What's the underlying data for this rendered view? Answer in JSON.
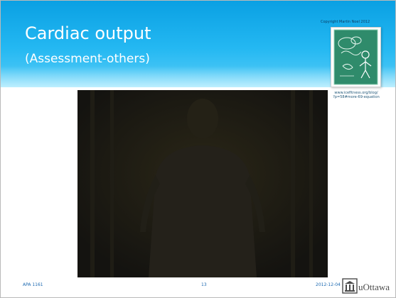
{
  "slide": {
    "title": "Cardiac output",
    "subtitle": "(Assessment-others)",
    "copyright": "Copyright Martin Noel 2012",
    "cartoon_url_line1": "www.icefitness.org/blog/",
    "cartoon_url_line2": "?p=58#more-69-equation"
  },
  "footer": {
    "course": "APA 1161",
    "page_number": "13",
    "date": "2012-12-04",
    "logo_text": "uOttawa",
    "logo_icon": "university-building-icon"
  },
  "colors": {
    "header_blue": "#0aa0e3",
    "footer_blue": "#1c69b1",
    "video_background": "#1b1912",
    "chalkboard_green": "#2f8b6b"
  }
}
